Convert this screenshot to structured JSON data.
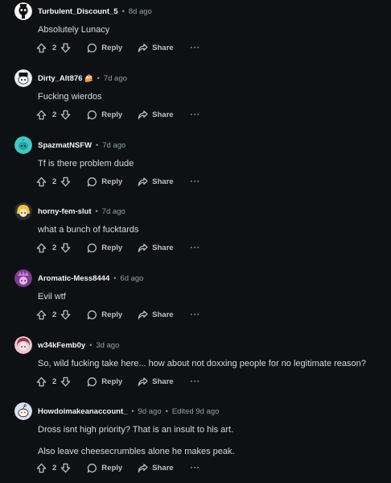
{
  "actions": {
    "reply_label": "Reply",
    "share_label": "Share",
    "more_label": "···"
  },
  "comments": [
    {
      "username": "Turbulent_Discount_5",
      "badge": "",
      "age": "8d ago",
      "edited": "",
      "lines": [
        "Absolutely Lunacy"
      ],
      "votes": "2",
      "avatar": "avatar-skull-black",
      "avatar_bg": "#f5f5f5"
    },
    {
      "username": "Dirty_Alt876",
      "badge": "🍰",
      "age": "7d ago",
      "edited": "",
      "lines": [
        "Fucking wierdos"
      ],
      "votes": "2",
      "avatar": "avatar-snoo-black-hat",
      "avatar_bg": "#e9ecef"
    },
    {
      "username": "SpazmatNSFW",
      "badge": "",
      "age": "7d ago",
      "edited": "",
      "lines": [
        "Tf is there problem dude"
      ],
      "votes": "2",
      "avatar": "avatar-snoo-teal",
      "avatar_bg": "#41c7c7"
    },
    {
      "username": "horny-fem-slut",
      "badge": "",
      "age": "7d ago",
      "edited": "",
      "lines": [
        "what a bunch of fucktards"
      ],
      "votes": "2",
      "avatar": "avatar-blonde",
      "avatar_bg": "#f0c43a"
    },
    {
      "username": "Aromatic-Mess8444",
      "badge": "",
      "age": "6d ago",
      "edited": "",
      "lines": [
        "Evil wtf"
      ],
      "votes": "2",
      "avatar": "avatar-purple",
      "avatar_bg": "#7c3d8f"
    },
    {
      "username": "w34kFemb0y",
      "badge": "",
      "age": "3d ago",
      "edited": "",
      "lines": [
        "So, wild fucking take here... how about not doxxing people for no legitimate reason?"
      ],
      "votes": "2",
      "avatar": "avatar-pink",
      "avatar_bg": "#f3c6cf"
    },
    {
      "username": "Howdoimakeanaccount_",
      "badge": "",
      "age": "9d ago",
      "edited": "Edited 9d ago",
      "lines": [
        "Dross isnt high priority? That is an insult to his art.",
        "Also leave cheesecrumbles alone he makes peak."
      ],
      "votes": "2",
      "avatar": "avatar-snoo-default",
      "avatar_bg": "#d7e4f0"
    }
  ]
}
